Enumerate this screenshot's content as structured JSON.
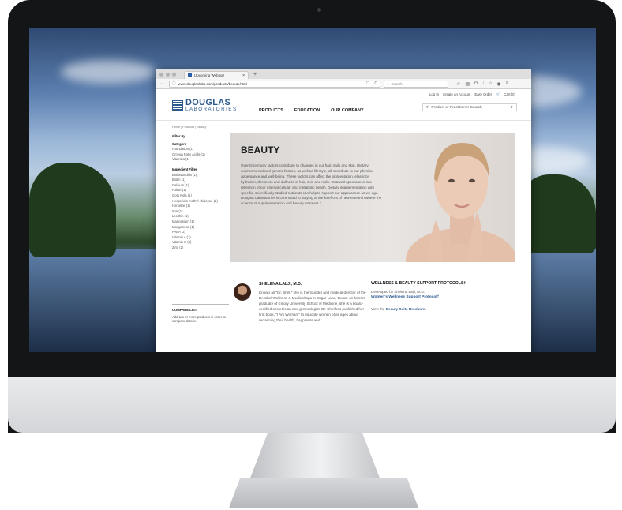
{
  "browser": {
    "tab_title": "Upcoming Webinar",
    "tab_close": "×",
    "new_tab": "+",
    "back": "←",
    "info_icon": "ⓘ",
    "url": "www.douglaslabs.com/products/beauty.html",
    "search_placeholder": "Search",
    "reload": "C",
    "reader": "☐"
  },
  "site": {
    "logo_top": "DOUGLAS",
    "logo_bottom": "LABORATORIES",
    "nav": [
      "PRODUCTS",
      "EDUCATION",
      "OUR COMPANY"
    ],
    "util_links": [
      "Log In",
      "Create an Account",
      "Easy Order",
      "Cart (0)"
    ],
    "product_search_placeholder": "Product or Practitioner Search",
    "breadcrumb": "Home | Products | Beauty"
  },
  "sidebar": {
    "filter_by": "Filter By",
    "category_heading": "Category",
    "categories": [
      "Foundation (1)",
      "Omega Fatty Acids (1)",
      "Vitamins (1)"
    ],
    "ingredient_heading": "Ingredient Filter",
    "ingredients": [
      "Bioflavonoids (1)",
      "Biotin (1)",
      "Calcium (1)",
      "Folate (1)",
      "Gotu Kola (1)",
      "Hesperidin methyl chalcone (1)",
      "Horsetail (1)",
      "Iron (1)",
      "Lecithin (1)",
      "Magnesium (1)",
      "Manganese (1)",
      "PABA (2)",
      "Vitamin A (1)",
      "Vitamin C (3)",
      "Zinc (2)"
    ],
    "compare_heading": "COMPARE LIST",
    "compare_text": "Add two or more products in order to compare details."
  },
  "hero": {
    "title": "BEAUTY",
    "text": "Over time many factors contribute to changes in our hair, nails and skin. Dietary, environmental and genetic factors, as well as lifestyle, all contribute to our physical appearance and well-being. These factors can affect the pigmentation, elasticity, hydration, thickness and dullness of hair, skin and nails. Outward appearance is a reflection of our internal cellular and metabolic health. Dietary supplementation with specific, scientifically studied nutrients can help to support our appearance as we age. Douglas Laboratories is committed to staying at the forefront of new research where the science of supplementation and beauty intersect.†"
  },
  "bio": {
    "name": "SHELENA LALJI, M.D.",
    "text": "Known as \"Dr. Shel,\" she is the founder and medical director of the Dr. Shel Wellness & Medical Spa in Sugar Land, Texas. An honors graduate of Emory University School of Medicine, she is a board-certified obstetrician and gynecologist. Dr. Shel has published her first book, \"I Am Woman,\" to educate women of all ages about reclaiming their health, happiness and"
  },
  "wellness": {
    "heading": "WELLNESS & BEAUTY SUPPORT PROTOCOLS†",
    "developed_by": "Developed by Shelena Lalji, M.D.",
    "protocol_link": "Women's Wellness Support Protocol†",
    "view_prefix": "View the",
    "brochure_link": "Beauty Suite Brochure."
  }
}
